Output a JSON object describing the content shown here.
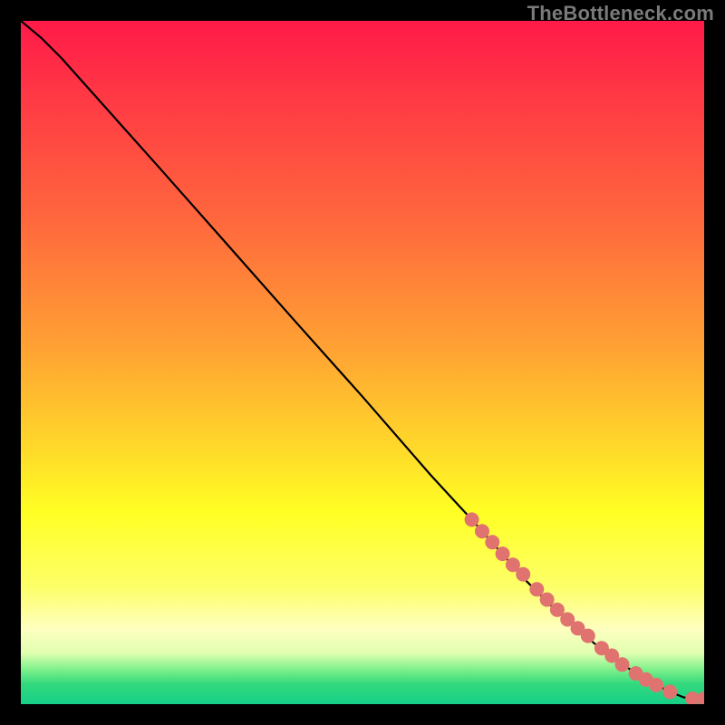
{
  "watermark": "TheBottleneck.com",
  "chart_data": {
    "type": "line",
    "title": "",
    "xlabel": "",
    "ylabel": "",
    "xlim": [
      0,
      100
    ],
    "ylim": [
      0,
      100
    ],
    "grid": false,
    "legend": false,
    "note": "Axes carry no tick labels in the source image; values below are normalized 0–100 estimates read from pixel positions.",
    "series": [
      {
        "name": "curve",
        "style": "line",
        "color": "#000000",
        "x": [
          0,
          3,
          6,
          10,
          20,
          30,
          40,
          50,
          60,
          66,
          70,
          74,
          78,
          82,
          85,
          88,
          91,
          93,
          95,
          97,
          98.5,
          100
        ],
        "y": [
          100,
          97.5,
          94.5,
          90,
          78.8,
          67.5,
          56.2,
          45,
          33.5,
          27,
          22.5,
          18,
          14,
          10.5,
          8,
          5.8,
          4,
          2.8,
          1.8,
          1,
          0.8,
          0.8
        ]
      },
      {
        "name": "points",
        "style": "scatter",
        "color": "#e0736f",
        "x": [
          66,
          67.5,
          69,
          70.5,
          72,
          73.5,
          75.5,
          77,
          78.5,
          80,
          81.5,
          83,
          85,
          86.5,
          88,
          90,
          91.5,
          93,
          95,
          98.3,
          100
        ],
        "y": [
          27,
          25.3,
          23.7,
          22,
          20.4,
          19,
          16.8,
          15.3,
          13.8,
          12.4,
          11.1,
          10,
          8.2,
          7.1,
          5.8,
          4.5,
          3.6,
          2.8,
          1.8,
          0.8,
          0.8
        ]
      }
    ],
    "background_gradient_stops": [
      {
        "pos": 0.0,
        "color": "#ff1a49"
      },
      {
        "pos": 0.3,
        "color": "#ff6a3d"
      },
      {
        "pos": 0.62,
        "color": "#ffd72a"
      },
      {
        "pos": 0.83,
        "color": "#fdff6a"
      },
      {
        "pos": 0.92,
        "color": "#e1ffb0"
      },
      {
        "pos": 1.0,
        "color": "#16cf87"
      }
    ]
  }
}
